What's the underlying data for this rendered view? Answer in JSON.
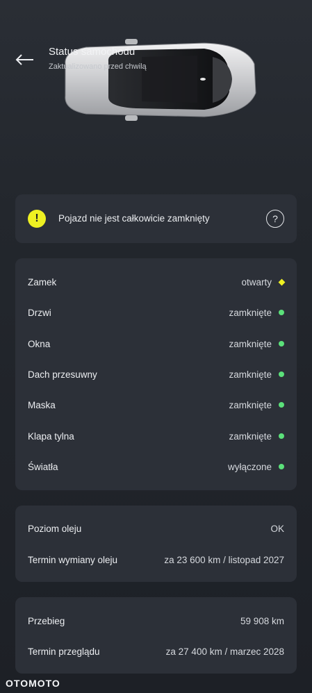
{
  "header": {
    "title": "Status samochodu",
    "subtitle": "Zaktualizowano przed chwilą"
  },
  "alert": {
    "icon": "!",
    "message": "Pojazd nie jest całkowicie zamknięty",
    "help_icon": "?"
  },
  "status": {
    "items": [
      {
        "label": "Zamek",
        "value": "otwarty",
        "indicator": "warning",
        "color": "#eef022"
      },
      {
        "label": "Drzwi",
        "value": "zamknięte",
        "indicator": "ok",
        "color": "#5be07a"
      },
      {
        "label": "Okna",
        "value": "zamknięte",
        "indicator": "ok",
        "color": "#5be07a"
      },
      {
        "label": "Dach przesuwny",
        "value": "zamknięte",
        "indicator": "ok",
        "color": "#5be07a"
      },
      {
        "label": "Maska",
        "value": "zamknięte",
        "indicator": "ok",
        "color": "#5be07a"
      },
      {
        "label": "Klapa tylna",
        "value": "zamknięte",
        "indicator": "ok",
        "color": "#5be07a"
      },
      {
        "label": "Światła",
        "value": "wyłączone",
        "indicator": "ok",
        "color": "#5be07a"
      }
    ]
  },
  "oil": {
    "items": [
      {
        "label": "Poziom oleju",
        "value": "OK"
      },
      {
        "label": "Termin wymiany oleju",
        "value": "za 23 600 km / listopad 2027"
      }
    ]
  },
  "mileage": {
    "items": [
      {
        "label": "Przebieg",
        "value": "59 908 km"
      },
      {
        "label": "Termin przeglądu",
        "value": "za 27 400 km / marzec 2028"
      }
    ]
  },
  "watermark": "OTOMOTO"
}
